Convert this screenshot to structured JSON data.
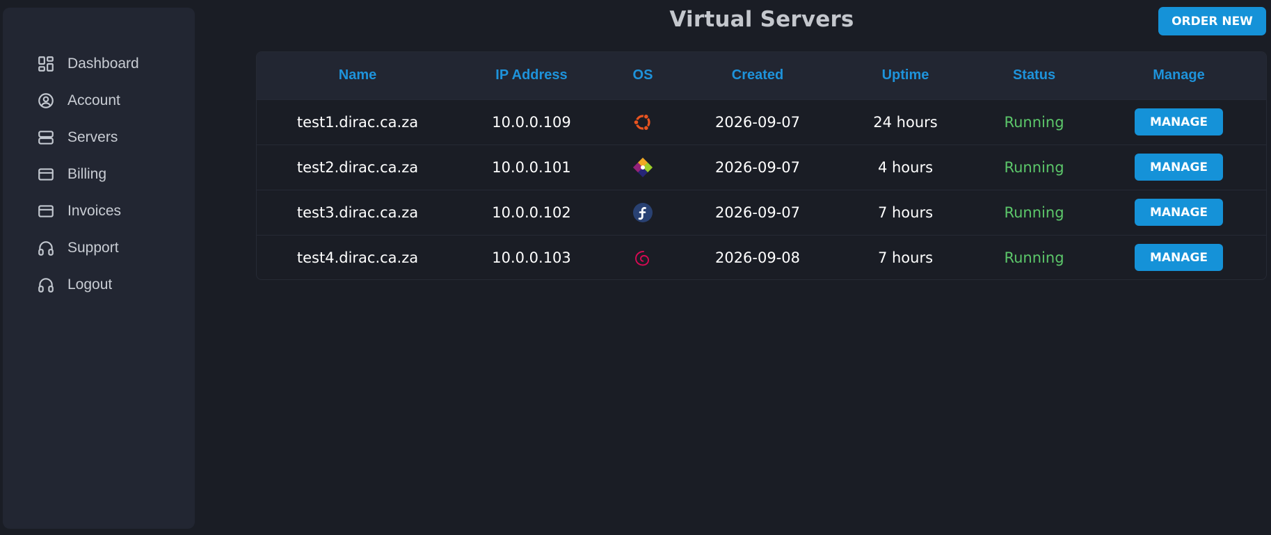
{
  "page": {
    "title": "Virtual Servers",
    "order_new_label": "ORDER NEW"
  },
  "sidebar": {
    "items": [
      {
        "label": "Dashboard",
        "icon": "dashboard-icon"
      },
      {
        "label": "Account",
        "icon": "user-circle-icon"
      },
      {
        "label": "Servers",
        "icon": "server-icon"
      },
      {
        "label": "Billing",
        "icon": "credit-card-icon"
      },
      {
        "label": "Invoices",
        "icon": "credit-card-icon"
      },
      {
        "label": "Support",
        "icon": "headset-icon"
      },
      {
        "label": "Logout",
        "icon": "headset-icon"
      }
    ]
  },
  "table": {
    "headers": [
      "Name",
      "IP Address",
      "OS",
      "Created",
      "Uptime",
      "Status",
      "Manage"
    ],
    "rows": [
      {
        "name": "test1.dirac.ca.za",
        "ip": "10.0.0.109",
        "os_icon": "ubuntu-icon",
        "created": "2026-09-07",
        "uptime": "24 hours",
        "status": "Running",
        "manage_label": "MANAGE"
      },
      {
        "name": "test2.dirac.ca.za",
        "ip": "10.0.0.101",
        "os_icon": "centos-icon",
        "created": "2026-09-07",
        "uptime": "4 hours",
        "status": "Running",
        "manage_label": "MANAGE"
      },
      {
        "name": "test3.dirac.ca.za",
        "ip": "10.0.0.102",
        "os_icon": "fedora-icon",
        "created": "2026-09-07",
        "uptime": "7 hours",
        "status": "Running",
        "manage_label": "MANAGE"
      },
      {
        "name": "test4.dirac.ca.za",
        "ip": "10.0.0.103",
        "os_icon": "debian-icon",
        "created": "2026-09-08",
        "uptime": "7 hours",
        "status": "Running",
        "manage_label": "MANAGE"
      }
    ]
  },
  "colors": {
    "background": "#1a1d25",
    "sidebar": "#222632",
    "accent": "#1592d8",
    "header_text": "#1e93db",
    "status_running": "#5cc76a"
  }
}
